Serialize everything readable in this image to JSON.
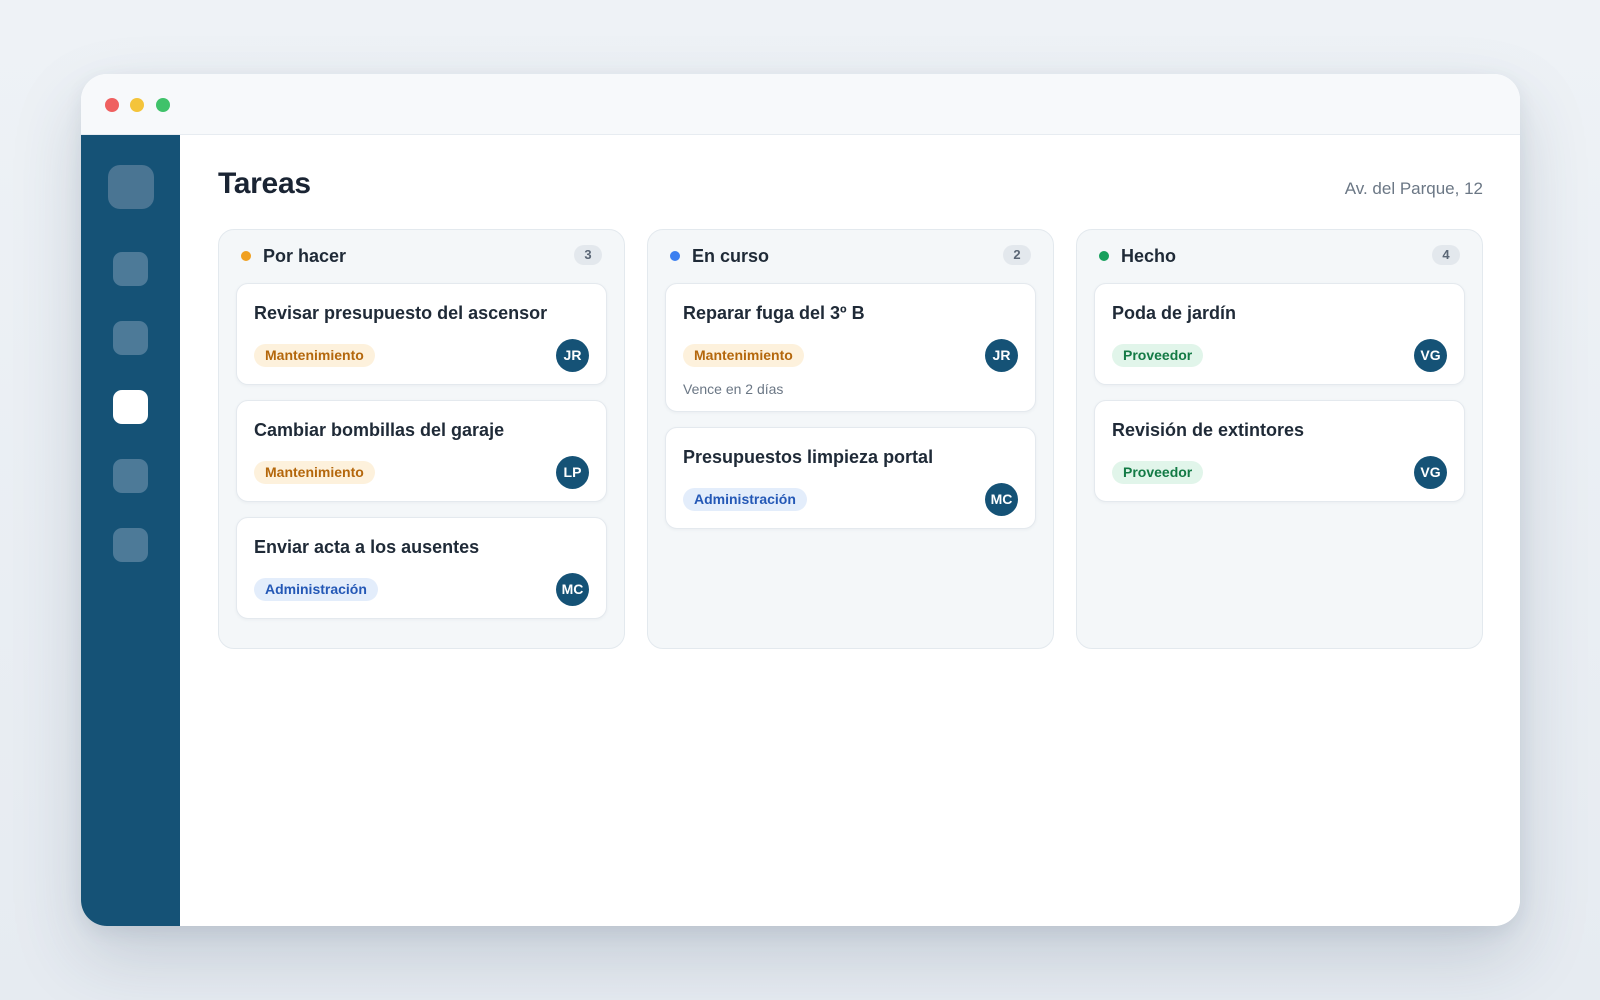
{
  "page": {
    "title": "Tareas",
    "address": "Av. del Parque, 12"
  },
  "colors": {
    "sidebar": "#155276",
    "todo": "#f0a020",
    "in_progress": "#3b7ff0",
    "done": "#16a05c"
  },
  "sidebar": {
    "items": [
      {
        "icon": "home-icon",
        "active": false
      },
      {
        "icon": "list-icon",
        "active": false
      },
      {
        "icon": "tasks-icon",
        "active": true
      },
      {
        "icon": "calendar-icon",
        "active": false
      },
      {
        "icon": "settings-icon",
        "active": false
      }
    ]
  },
  "columns": [
    {
      "title": "Por hacer",
      "count": "3",
      "cards": [
        {
          "title": "Revisar presupuesto del ascensor",
          "tag": "Mantenimiento",
          "assignee": "JR"
        },
        {
          "title": "Cambiar bombillas del garaje",
          "tag": "Mantenimiento",
          "assignee": "LP"
        },
        {
          "title": "Enviar acta a los ausentes",
          "tag": "Administración",
          "assignee": "MC"
        }
      ]
    },
    {
      "title": "En curso",
      "count": "2",
      "cards": [
        {
          "title": "Reparar fuga del 3º B",
          "tag": "Mantenimiento",
          "assignee": "JR",
          "due": "Vence en 2 días"
        },
        {
          "title": "Presupuestos limpieza portal",
          "tag": "Administración",
          "assignee": "MC"
        }
      ]
    },
    {
      "title": "Hecho",
      "count": "4",
      "cards": [
        {
          "title": "Poda de jardín",
          "tag": "Proveedor",
          "assignee": "VG"
        },
        {
          "title": "Revisión de extintores",
          "tag": "Proveedor",
          "assignee": "VG"
        }
      ]
    }
  ]
}
